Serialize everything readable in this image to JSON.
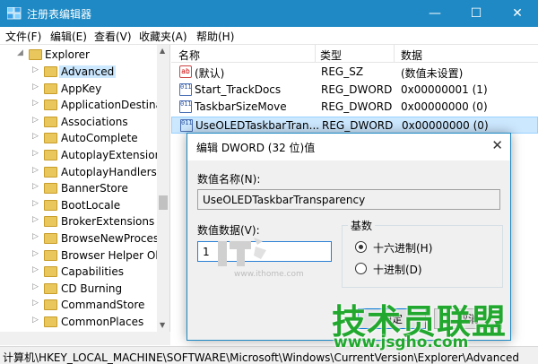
{
  "window": {
    "title": "注册表编辑器",
    "minimize_glyph": "—",
    "maximize_glyph": "☐",
    "close_glyph": "✕"
  },
  "menu": [
    "文件(F)",
    "编辑(E)",
    "查看(V)",
    "收藏夹(A)",
    "帮助(H)"
  ],
  "tree": {
    "root": "Explorer",
    "items": [
      "Advanced",
      "AppKey",
      "ApplicationDestinat",
      "Associations",
      "AutoComplete",
      "AutoplayExtensions",
      "AutoplayHandlers",
      "BannerStore",
      "BootLocale",
      "BrokerExtensions",
      "BrowseNewProcess",
      "Browser Helper Ob",
      "Capabilities",
      "CD Burning",
      "CommandStore",
      "CommonPlaces"
    ],
    "selected": "Advanced"
  },
  "list": {
    "headers": [
      "名称",
      "类型",
      "数据"
    ],
    "rows": [
      {
        "icon": "ab",
        "name": "(默认)",
        "type": "REG_SZ",
        "data": "(数值未设置)"
      },
      {
        "icon": "011",
        "name": "Start_TrackDocs",
        "type": "REG_DWORD",
        "data": "0x00000001 (1)"
      },
      {
        "icon": "011",
        "name": "TaskbarSizeMove",
        "type": "REG_DWORD",
        "data": "0x00000000 (0)"
      },
      {
        "icon": "011",
        "name": "UseOLEDTaskbarTran...",
        "type": "REG_DWORD",
        "data": "0x00000000 (0)"
      }
    ]
  },
  "statusbar": {
    "path": "计算机\\HKEY_LOCAL_MACHINE\\SOFTWARE\\Microsoft\\Windows\\CurrentVersion\\Explorer\\Advanced"
  },
  "dialog": {
    "title": "编辑 DWORD (32 位)值",
    "close_glyph": "✕",
    "name_label": "数值名称(N):",
    "name_value": "UseOLEDTaskbarTransparency",
    "data_label": "数值数据(V):",
    "data_value": "1",
    "base_label": "基数",
    "radios": [
      {
        "label": "十六进制(H)",
        "checked": true
      },
      {
        "label": "十进制(D)",
        "checked": false
      }
    ],
    "ok_label": "确定",
    "cancel_label": "取消"
  },
  "watermarks": {
    "ithome_url": "www.ithome.com",
    "jsgho_text": "技术员联盟",
    "jsgho_url": "www.jsgho.com"
  },
  "colors": {
    "titlebar": "#1e89c4",
    "selection": "#cce8ff",
    "watermark_green": "#22a82e"
  }
}
